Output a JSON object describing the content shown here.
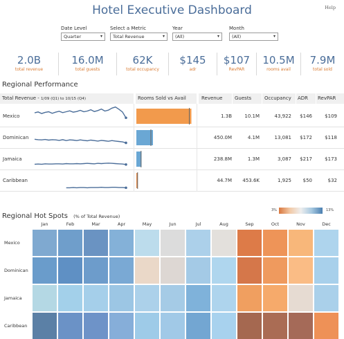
{
  "header": {
    "title": "Hotel Executive Dashboard",
    "help": "Help"
  },
  "filters": [
    {
      "label": "Date Level",
      "value": "Quarter"
    },
    {
      "label": "Select a Metric",
      "value": "Total Revenue"
    },
    {
      "label": "Year",
      "value": "(All)"
    },
    {
      "label": "Month",
      "value": "(All)"
    }
  ],
  "kpis": [
    {
      "value": "2.0B",
      "label": "total revenue"
    },
    {
      "value": "16.0M",
      "label": "total guests"
    },
    {
      "value": "62K",
      "label": "total occupancy"
    },
    {
      "value": "$145",
      "label": "adr"
    },
    {
      "value": "$107",
      "label": "RevPAR"
    },
    {
      "value": "10.5M",
      "label": "rooms avail"
    },
    {
      "value": "7.9M",
      "label": "total sold"
    }
  ],
  "regional": {
    "title": "Regional Performance",
    "sparkline_header_main": "Total Revenue - ",
    "sparkline_header_range": "1/09 (Q1) to 10/15 (Q4)",
    "columns": [
      "Rooms Sold vs Avail",
      "Revenue",
      "Guests",
      "Occupancy",
      "ADR",
      "RevPAR"
    ],
    "rows": [
      {
        "name": "Mexico",
        "revenue": "1.3B",
        "guests": "10.1M",
        "occupancy": "43,922",
        "adr": "$146",
        "revpar": "$109",
        "rooms_sold_m": 5.3,
        "rooms_avail_m": 5.1,
        "spark": [
          52,
          56,
          49,
          54,
          57,
          50,
          55,
          59,
          53,
          57,
          61,
          55,
          58,
          63,
          57,
          60,
          66,
          58,
          62,
          69,
          60,
          64,
          73,
          78,
          68,
          56,
          30
        ]
      },
      {
        "name": "Dominican",
        "revenue": "450.0M",
        "guests": "4.1M",
        "occupancy": "13,081",
        "adr": "$172",
        "revpar": "$118",
        "rooms_sold_m": 1.6,
        "rooms_avail_m": 1.4,
        "spark": [
          30,
          28,
          27,
          29,
          26,
          28,
          27,
          25,
          28,
          24,
          27,
          26,
          24,
          27,
          25,
          23,
          26,
          24,
          22,
          25,
          23,
          21,
          24,
          22,
          20,
          18,
          14
        ]
      },
      {
        "name": "Jamaica",
        "revenue": "238.8M",
        "guests": "1.3M",
        "occupancy": "3,087",
        "adr": "$217",
        "revpar": "$173",
        "rooms_sold_m": 0.5,
        "rooms_avail_m": 0.45,
        "spark": [
          14,
          15,
          14,
          16,
          15,
          15,
          16,
          16,
          15,
          17,
          16,
          16,
          17,
          16,
          17,
          18,
          17,
          16,
          18,
          17,
          18,
          19,
          18,
          17,
          16,
          15,
          13
        ]
      },
      {
        "name": "Caribbean",
        "revenue": "44.7M",
        "guests": "453.6K",
        "occupancy": "1,925",
        "adr": "$50",
        "revpar": "$32",
        "rooms_sold_m": 0.1,
        "rooms_avail_m": 0.12,
        "spark": [
          null,
          null,
          null,
          null,
          null,
          null,
          null,
          null,
          null,
          5,
          5,
          6,
          5,
          6,
          6,
          5,
          6,
          6,
          6,
          7,
          6,
          6,
          7,
          7,
          6,
          6,
          5
        ]
      }
    ]
  },
  "hotspots": {
    "title": "Regional Hot Spots",
    "subtitle": "(% of Total Revenue)",
    "legend_min": "3%",
    "legend_max": "13%",
    "months": [
      "Jan",
      "Feb",
      "Mar",
      "Apr",
      "May",
      "Jun",
      "Jul",
      "Aug",
      "Sep",
      "Oct",
      "Nov",
      "Dec"
    ],
    "rows": [
      "Mexico",
      "Dominican",
      "Jamaica",
      "Caribbean"
    ],
    "colors": {
      "Mexico": [
        "#7fa9d0",
        "#6f9ecb",
        "#6a93c2",
        "#84b1d8",
        "#bcdcec",
        "#dcdcdc",
        "#acd0ea",
        "#e3e0dc",
        "#dd7b48",
        "#ee9458",
        "#f8b77a",
        "#aed4ed"
      ],
      "Dominican": [
        "#6a9ccb",
        "#5f90c4",
        "#6d9ccb",
        "#7aa9d4",
        "#ead8c8",
        "#ddd7d3",
        "#a4cae6",
        "#afd6ee",
        "#d5774a",
        "#ef9a5e",
        "#fabc85",
        "#a8d0eb"
      ],
      "Jamaica": [
        "#b4d8e4",
        "#a3d0ea",
        "#a5cfea",
        "#9cc6e4",
        "#acd1ea",
        "#a5cbe6",
        "#7fb2da",
        "#aed4ed",
        "#f09f60",
        "#f6aa6b",
        "#e6dbd2",
        "#aad0ea"
      ],
      "Caribbean": [
        "#5b80a6",
        "#6b92c6",
        "#6e93c8",
        "#86aed9",
        "#9ecbe8",
        "#a1c9e7",
        "#73a6d2",
        "#a8d2ee",
        "#a56850",
        "#aa6c54",
        "#a56a58",
        "#ee9157"
      ]
    }
  }
}
